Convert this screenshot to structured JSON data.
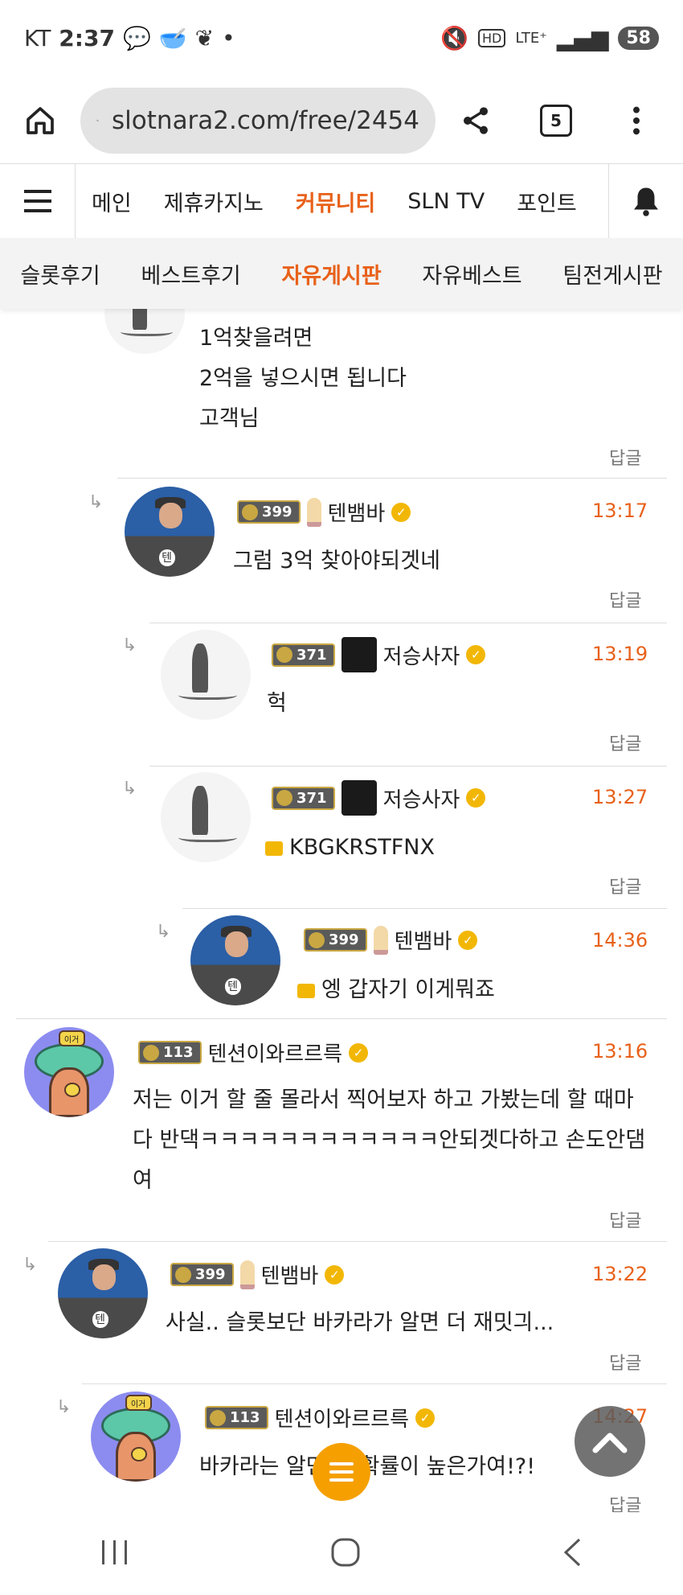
{
  "statusbar": {
    "carrier": "KT",
    "time": "2:37",
    "battery": "58",
    "dot": "•"
  },
  "url": {
    "text": "slotnara2.com/free/2454",
    "tab_count": "5"
  },
  "nav": {
    "items": [
      "메인",
      "제휴카지노",
      "커뮤니티",
      "SLN TV",
      "포인트"
    ],
    "active_index": 2
  },
  "subnav": {
    "items": [
      "슬롯후기",
      "베스트후기",
      "자유게시판",
      "자유베스트",
      "팀전게시판"
    ],
    "active_index": 2
  },
  "reply_label": "답글",
  "comments": [
    {
      "id": "c0",
      "lines": [
        "1억찾을려면",
        "2억을 넣으시면 됩니다",
        "고객님"
      ]
    },
    {
      "id": "c1",
      "level": "399",
      "name": "텐뱀바",
      "time": "13:17",
      "text": "그럼 3억 찾아야되겟네"
    },
    {
      "id": "c2",
      "level": "371",
      "name": "저승사자",
      "time": "13:19",
      "text": "헉"
    },
    {
      "id": "c3",
      "level": "371",
      "name": "저승사자",
      "time": "13:27",
      "text": "KBGKRSTFNX"
    },
    {
      "id": "c4",
      "level": "399",
      "name": "텐뱀바",
      "time": "14:36",
      "text": "엥 갑자기 이게뭐죠"
    },
    {
      "id": "c5",
      "level": "113",
      "name": "텐션이와르르륵",
      "time": "13:16",
      "lines": [
        "저는 이거 할 줄 몰라서 찍어보자 하고 가봤는데 할 때마",
        "다 반댁ㅋㅋㅋㅋㅋㅋㅋㅋㅋㅋㅋㅋ안되겟다하고 손도안댐",
        "여"
      ]
    },
    {
      "id": "c6",
      "level": "399",
      "name": "텐뱀바",
      "time": "13:22",
      "text": "사실.. 슬롯보단 바카라가 알면 더 재밋긔..."
    },
    {
      "id": "c7",
      "level": "113",
      "name": "텐션이와르르륵",
      "time": "14:27",
      "text": "바카라는 알면 줄 확률이 높은가여!?!"
    }
  ],
  "avatar_tree_sign": "이거"
}
